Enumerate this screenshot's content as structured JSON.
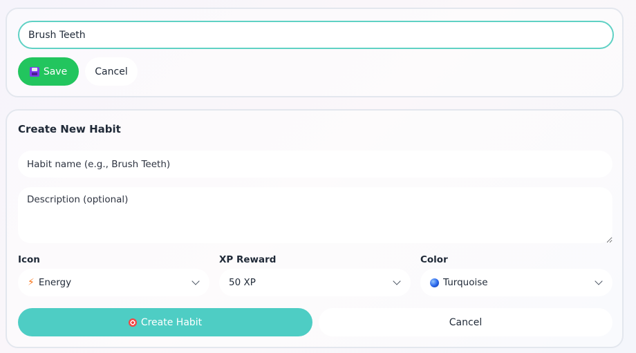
{
  "edit_form": {
    "name_value": "Brush Teeth",
    "save_label": "Save",
    "cancel_label": "Cancel",
    "save_icon": "floppy-disk-icon"
  },
  "create_form": {
    "title": "Create New Habit",
    "name_placeholder": "Habit name (e.g., Brush Teeth)",
    "description_placeholder": "Description (optional)",
    "icon_label": "Icon",
    "icon_value": "Energy",
    "icon_value_icon": "lightning-bolt-icon",
    "xp_label": "XP Reward",
    "xp_value": "50 XP",
    "color_label": "Color",
    "color_value": "Turquoise",
    "color_value_icon": "globe-icon",
    "create_label": "Create Habit",
    "create_icon": "target-icon",
    "cancel_label": "Cancel"
  },
  "colors": {
    "accent_teal": "#4ecdc4",
    "save_green": "#22c55e",
    "input_border": "#5fd1c4"
  }
}
